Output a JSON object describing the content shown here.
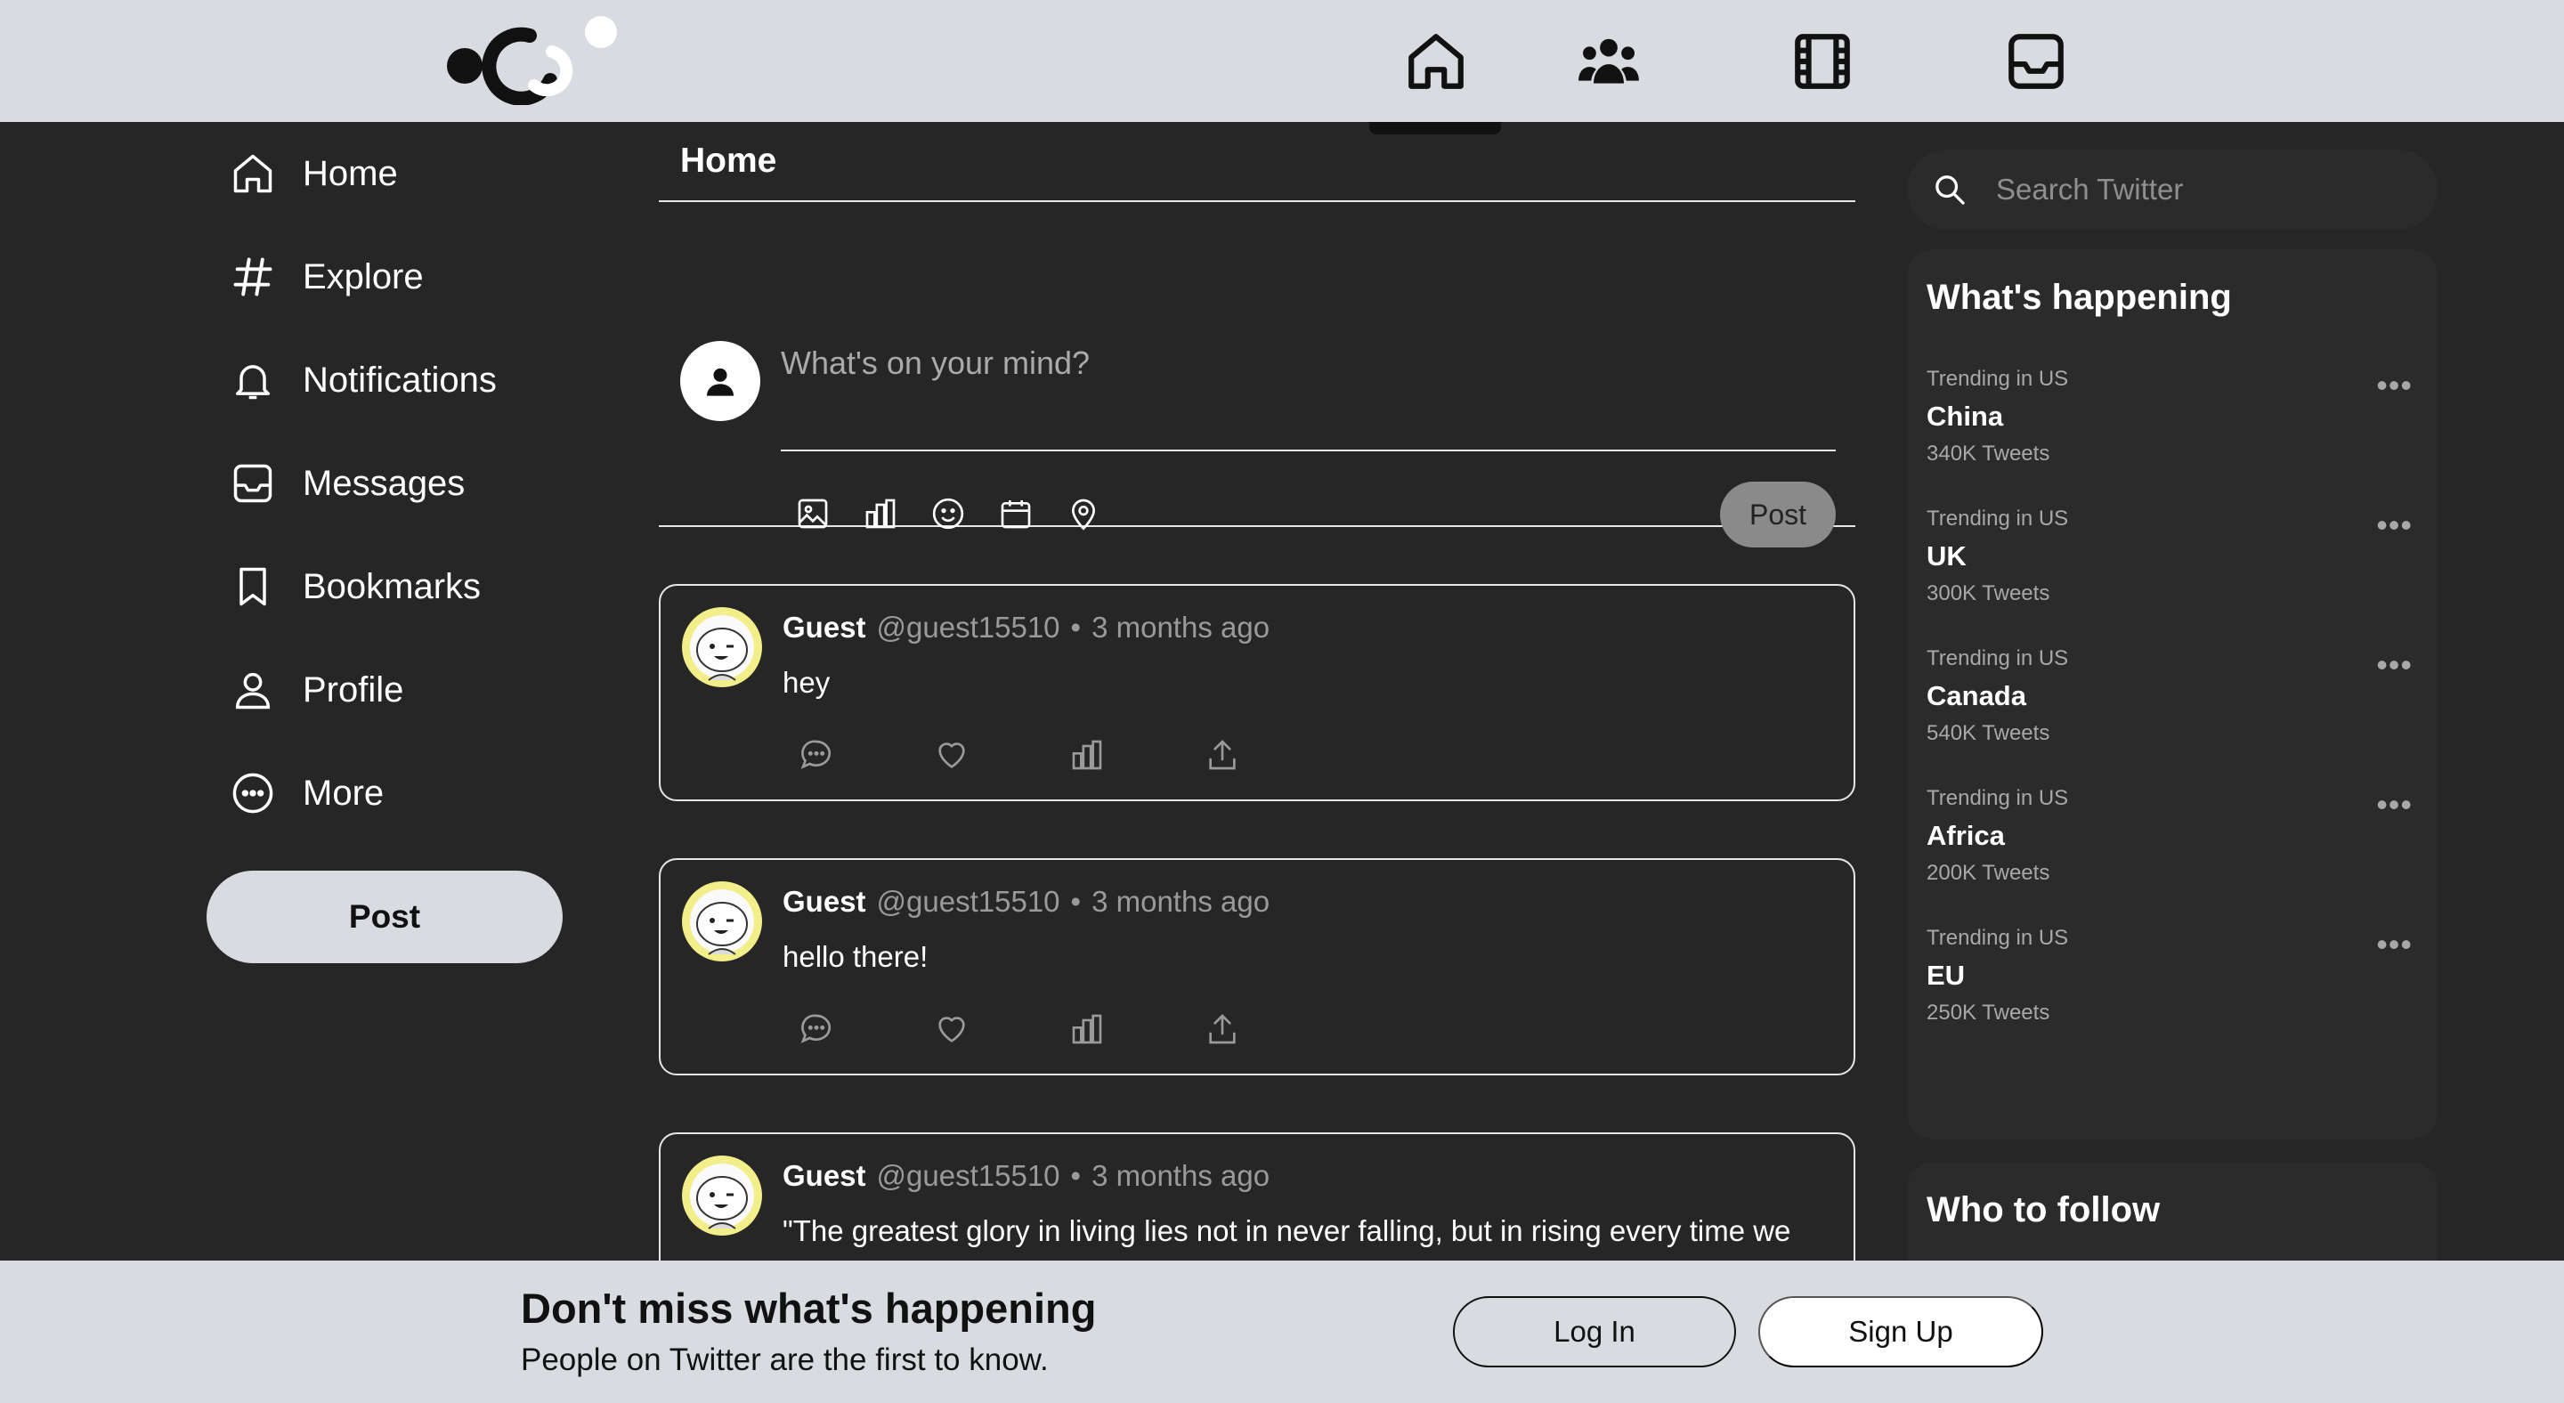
{
  "nav": {
    "logo": "logo-icon",
    "items": [
      {
        "icon": "home-icon",
        "active": true
      },
      {
        "icon": "people-icon",
        "active": false
      },
      {
        "icon": "film-icon",
        "active": false
      },
      {
        "icon": "inbox-icon",
        "active": false
      }
    ]
  },
  "sidebar": {
    "items": [
      {
        "label": "Home",
        "icon": "home-icon"
      },
      {
        "label": "Explore",
        "icon": "hashtag-icon"
      },
      {
        "label": "Notifications",
        "icon": "bell-icon"
      },
      {
        "label": "Messages",
        "icon": "inbox-icon"
      },
      {
        "label": "Bookmarks",
        "icon": "bookmark-icon"
      },
      {
        "label": "Profile",
        "icon": "person-icon"
      },
      {
        "label": "More",
        "icon": "more-circle-icon"
      }
    ],
    "post_label": "Post"
  },
  "main": {
    "title": "Home",
    "composer": {
      "placeholder": "What's on your mind?",
      "post_label": "Post",
      "tools": [
        "image-icon",
        "poll-icon",
        "emoji-icon",
        "calendar-icon",
        "location-icon"
      ]
    },
    "tweets": [
      {
        "name": "Guest",
        "handle": "@guest15510",
        "sep": "•",
        "time": "3 months ago",
        "text": "hey"
      },
      {
        "name": "Guest",
        "handle": "@guest15510",
        "sep": "•",
        "time": "3 months ago",
        "text": "hello there!"
      },
      {
        "name": "Guest",
        "handle": "@guest15510",
        "sep": "•",
        "time": "3 months ago",
        "text": "\"The greatest glory in living lies not in never falling, but in rising every time we fall\" - Nelson Mandela"
      }
    ]
  },
  "right": {
    "search_placeholder": "Search Twitter",
    "happening_title": "What's happening",
    "trends": [
      {
        "context": "Trending in US",
        "topic": "China",
        "count": "340K Tweets"
      },
      {
        "context": "Trending in US",
        "topic": "UK",
        "count": "300K Tweets"
      },
      {
        "context": "Trending in US",
        "topic": "Canada",
        "count": "540K Tweets"
      },
      {
        "context": "Trending in US",
        "topic": "Africa",
        "count": "200K Tweets"
      },
      {
        "context": "Trending in US",
        "topic": "EU",
        "count": "250K Tweets"
      }
    ],
    "more_dots": "•••",
    "follow_title": "Who to follow"
  },
  "banner": {
    "headline": "Don't miss what's happening",
    "subtext": "People on Twitter are the first to know.",
    "login_label": "Log In",
    "signup_label": "Sign Up"
  }
}
